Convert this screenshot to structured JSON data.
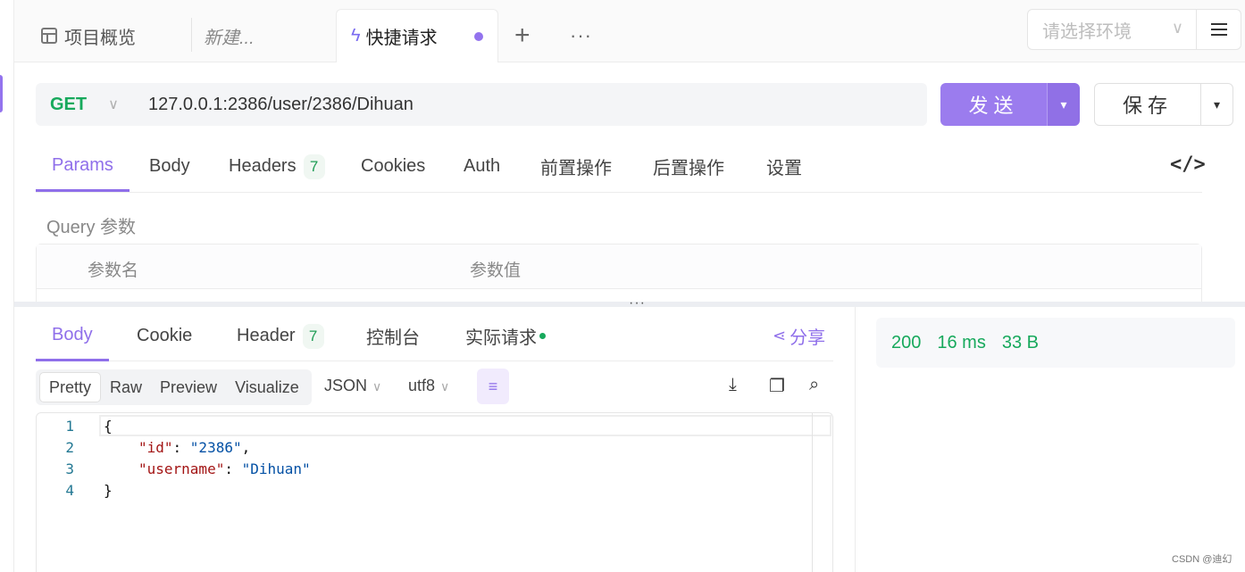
{
  "tabs": {
    "overview": "项目概览",
    "new": "新建...",
    "active": "快捷请求",
    "plus": "+",
    "more": "···"
  },
  "environment": {
    "placeholder": "请选择环境"
  },
  "request": {
    "method": "GET",
    "url": "127.0.0.1:2386/user/2386/Dihuan",
    "send_label": "发送",
    "save_label": "保存"
  },
  "request_tabs": {
    "params": "Params",
    "body": "Body",
    "headers": "Headers",
    "headers_count": "7",
    "cookies": "Cookies",
    "auth": "Auth",
    "pre": "前置操作",
    "post": "后置操作",
    "settings": "设置"
  },
  "query": {
    "label": "Query 参数",
    "col_name": "参数名",
    "col_value": "参数值"
  },
  "response_tabs": {
    "body": "Body",
    "cookie": "Cookie",
    "header": "Header",
    "header_count": "7",
    "console": "控制台",
    "actual": "实际请求",
    "share": "分享"
  },
  "view_modes": [
    "Pretty",
    "Raw",
    "Preview",
    "Visualize"
  ],
  "format": "JSON",
  "encoding": "utf8",
  "code_lines": [
    {
      "no": "1",
      "text": "{"
    },
    {
      "no": "2",
      "key": "\"id\"",
      "sep": ": ",
      "val": "\"2386\"",
      "tail": ","
    },
    {
      "no": "3",
      "key": "\"username\"",
      "sep": ": ",
      "val": "\"Dihuan\"",
      "tail": ""
    },
    {
      "no": "4",
      "text": "}"
    }
  ],
  "status": {
    "code": "200",
    "time": "16 ms",
    "size": "33 B"
  },
  "watermark": "CSDN @迪幻",
  "colors": {
    "accent": "#9b7cee",
    "success": "#17a95c"
  }
}
